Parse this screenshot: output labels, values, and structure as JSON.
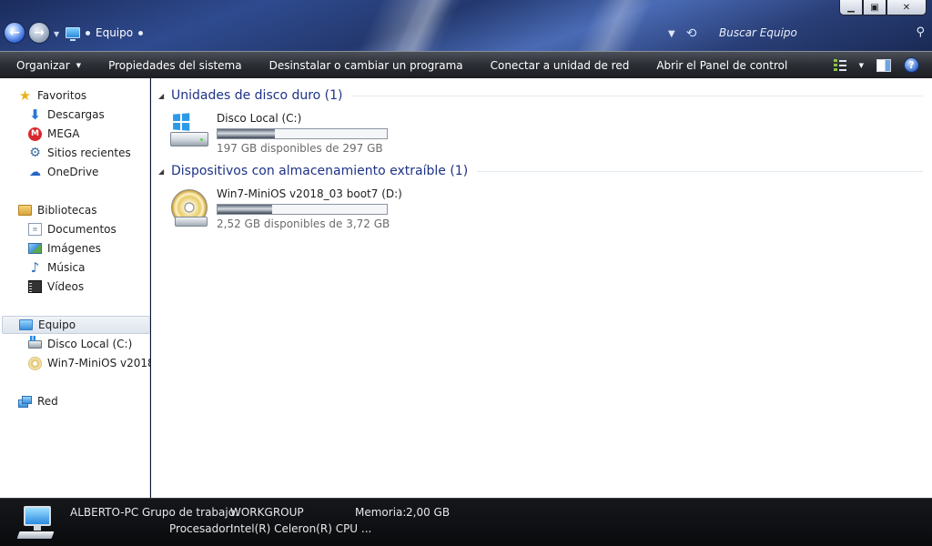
{
  "address": {
    "location": "Equipo",
    "search_placeholder": "Buscar Equipo"
  },
  "window_buttons": {
    "minimize": "▁",
    "maximize": "▣",
    "close": "✕"
  },
  "toolbar": {
    "organize": "Organizar",
    "system_properties": "Propiedades del sistema",
    "uninstall": "Desinstalar o cambiar un programa",
    "map_drive": "Conectar a unidad de red",
    "control_panel": "Abrir el Panel de control",
    "help": "?"
  },
  "nav": {
    "favorites": "Favoritos",
    "downloads": "Descargas",
    "mega": "MEGA",
    "recent": "Sitios recientes",
    "onedrive": "OneDrive",
    "libraries": "Bibliotecas",
    "documents": "Documentos",
    "images": "Imágenes",
    "music": "Música",
    "videos": "Vídeos",
    "computer": "Equipo",
    "drive_c": "Disco Local (C:)",
    "drive_d": "Win7-MiniOS v2018_03 boot7 (D:)",
    "network": "Red"
  },
  "groups": {
    "hard_disks": "Unidades de disco duro (1)",
    "removable": "Dispositivos con almacenamiento extraíble (1)"
  },
  "drives": [
    {
      "name": "Disco Local (C:)",
      "free_text": "197 GB disponibles de 297 GB",
      "used_fraction": 0.337
    },
    {
      "name": "Win7-MiniOS v2018_03 boot7 (D:)",
      "free_text": "2,52 GB disponibles de 3,72 GB",
      "used_fraction": 0.323
    }
  ],
  "details": {
    "computer_name": "ALBERTO-PC",
    "workgroup_label": "Grupo de trabajo:",
    "workgroup_value": "WORKGROUP",
    "memory_label": "Memoria:",
    "memory_value": "2,00 GB",
    "processor_label": "Procesador:",
    "processor_value": "Intel(R) Celeron(R) CPU ..."
  },
  "colors": {
    "group_title": "#1e3287",
    "accent": "#2b76d2"
  }
}
